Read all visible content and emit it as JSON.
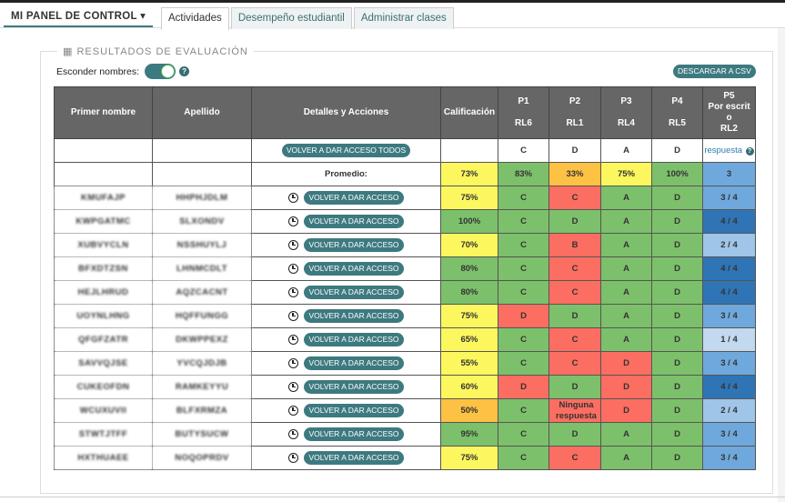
{
  "nav": {
    "dashboard_label": "MI PANEL DE CONTROL ▾",
    "tabs": [
      {
        "label": "Actividades",
        "active": true
      },
      {
        "label": "Desempeño estudiantil",
        "active": false
      },
      {
        "label": "Administrar clases",
        "active": false
      }
    ]
  },
  "panel": {
    "legend_icon": "table-icon",
    "legend": "▦ RESULTADOS DE EVALUACIÓN",
    "hide_names_label": "Esconder nombres:",
    "hide_names_on": true,
    "help_icon": "?",
    "csv_button": "DESCARGAR A CSV"
  },
  "table": {
    "headers": {
      "first_name": "Primer nombre",
      "last_name": "Apellido",
      "details": "Detalles y Acciones",
      "grade": "Calificación",
      "questions": [
        {
          "num": "P1",
          "sub": "RL6"
        },
        {
          "num": "P2",
          "sub": "RL1"
        },
        {
          "num": "P3",
          "sub": "RL4"
        },
        {
          "num": "P4",
          "sub": "RL5"
        },
        {
          "num": "P5",
          "sub1": "Por escrit",
          "sub2": "o",
          "sub3": "RL2"
        }
      ]
    },
    "answer_key": {
      "reset_all": "VOLVER A DAR ACCESO TODOS",
      "answers": [
        "C",
        "D",
        "A",
        "D"
      ],
      "p5": "respuesta",
      "p5_icon": "?"
    },
    "average": {
      "label": "Promedio:",
      "grade": "73%",
      "questions": [
        "83%",
        "33%",
        "75%",
        "100%",
        "3"
      ]
    },
    "reset_label": "VOLVER A DAR ACCESO",
    "rows": [
      {
        "first": "KMUFAJP",
        "last": "HHPHJDLM",
        "grade": "75%",
        "answers": [
          "C",
          "C",
          "A",
          "D"
        ],
        "p5": "3 / 4"
      },
      {
        "first": "KWPGATMC",
        "last": "SLXONDV",
        "grade": "100%",
        "answers": [
          "C",
          "D",
          "A",
          "D"
        ],
        "p5": "4 / 4"
      },
      {
        "first": "XUBVYCLN",
        "last": "NSSHUYLJ",
        "grade": "70%",
        "answers": [
          "C",
          "B",
          "A",
          "D"
        ],
        "p5": "2 / 4"
      },
      {
        "first": "BFXDTZSN",
        "last": "LHNMCDLT",
        "grade": "80%",
        "answers": [
          "C",
          "C",
          "A",
          "D"
        ],
        "p5": "4 / 4"
      },
      {
        "first": "HEJLHRUD",
        "last": "AQZCACNT",
        "grade": "80%",
        "answers": [
          "C",
          "C",
          "A",
          "D"
        ],
        "p5": "4 / 4"
      },
      {
        "first": "UOYNLHNG",
        "last": "HQFFUNGG",
        "grade": "75%",
        "answers": [
          "D",
          "D",
          "A",
          "D"
        ],
        "p5": "3 / 4"
      },
      {
        "first": "QFGFZATR",
        "last": "DKWPPEXZ",
        "grade": "65%",
        "answers": [
          "C",
          "C",
          "A",
          "D"
        ],
        "p5": "1 / 4"
      },
      {
        "first": "SAVVQJSE",
        "last": "YVCQJDJB",
        "grade": "55%",
        "answers": [
          "C",
          "C",
          "D",
          "D"
        ],
        "p5": "3 / 4"
      },
      {
        "first": "CUKEOFDN",
        "last": "RAMKEYYU",
        "grade": "60%",
        "answers": [
          "D",
          "D",
          "D",
          "D"
        ],
        "p5": "4 / 4"
      },
      {
        "first": "WCUXUVII",
        "last": "BLFXRMZA",
        "grade": "50%",
        "answers": [
          "C",
          "Ninguna respuesta",
          "D",
          "D"
        ],
        "p5": "2 / 4"
      },
      {
        "first": "STWTJTFF",
        "last": "BUTYSUCW",
        "grade": "95%",
        "answers": [
          "C",
          "D",
          "A",
          "D"
        ],
        "p5": "3 / 4"
      },
      {
        "first": "HXTHUAEE",
        "last": "NOQOPRDV",
        "grade": "75%",
        "answers": [
          "C",
          "C",
          "A",
          "D"
        ],
        "p5": "3 / 4"
      }
    ]
  },
  "colors": {
    "accent": "#3d7a80",
    "correct": "#7dc06b",
    "incorrect": "#fb6e61",
    "mid_grade": "#fcf75e",
    "low_grade": "#fdc143",
    "header_bg": "#666666"
  }
}
